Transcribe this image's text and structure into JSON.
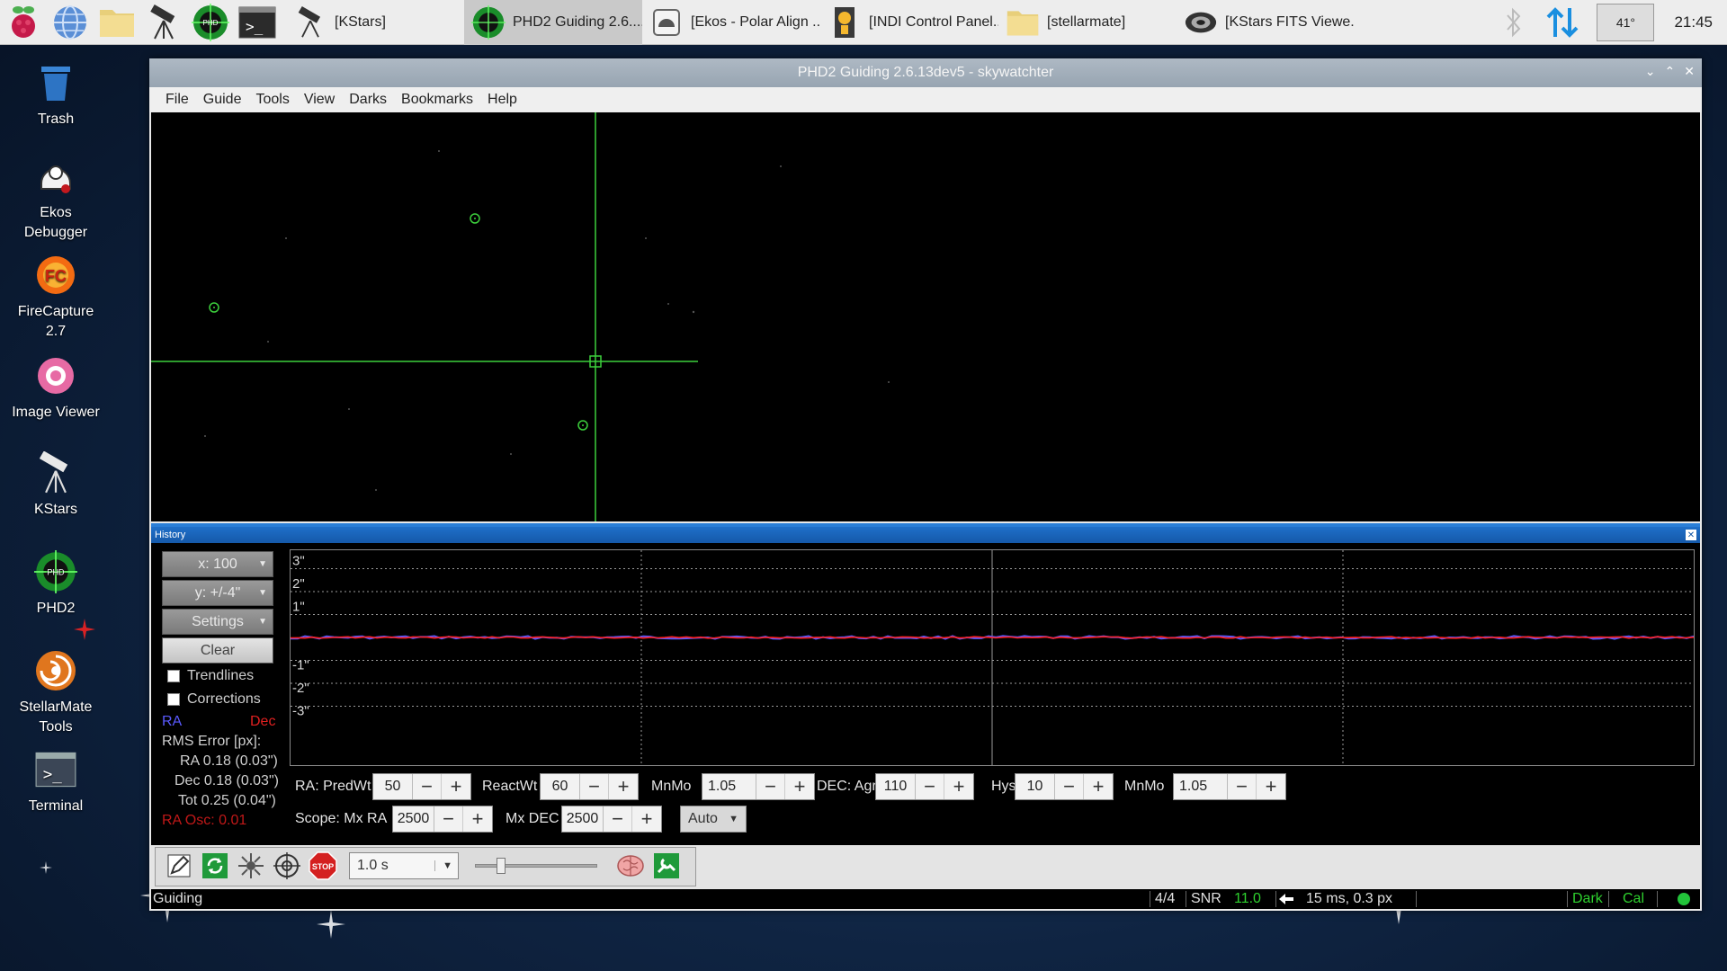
{
  "taskbar": {
    "tasks": [
      {
        "label": "[KStars]",
        "icon": "telescope-icon"
      },
      {
        "label": "PHD2 Guiding 2.6....",
        "icon": "phd2-icon",
        "active": true
      },
      {
        "label": "[Ekos - Polar Align ...",
        "icon": "ekos-icon"
      },
      {
        "label": "[INDI Control Panel...",
        "icon": "indi-icon"
      },
      {
        "label": "[stellarmate]",
        "icon": "folder-icon"
      },
      {
        "label": "[KStars FITS Viewe...",
        "icon": "fits-viewer-icon"
      }
    ],
    "temperature": "41°",
    "clock": "21:45"
  },
  "desktop": {
    "icons": [
      {
        "label": "Trash"
      },
      {
        "label": "Ekos\nDebugger"
      },
      {
        "label": "FireCapture\n2.7"
      },
      {
        "label": "Image Viewer"
      },
      {
        "label": "KStars"
      },
      {
        "label": "PHD2"
      },
      {
        "label": "StellarMate\nTools"
      },
      {
        "label": "Terminal"
      }
    ]
  },
  "window": {
    "title": "PHD2 Guiding 2.6.13dev5 - skywatchter",
    "menu": [
      "File",
      "Guide",
      "Tools",
      "View",
      "Darks",
      "Bookmarks",
      "Help"
    ]
  },
  "history": {
    "title": "History",
    "x_scale": "x: 100",
    "y_scale": "y: +/-4\"",
    "settings": "Settings",
    "clear": "Clear",
    "trendlines": "Trendlines",
    "corrections": "Corrections",
    "ra_label": "RA",
    "dec_label": "Dec",
    "rms_title": "RMS Error [px]:",
    "rms_ra": "RA 0.18 (0.03\")",
    "rms_dec": "Dec 0.18 (0.03\")",
    "rms_tot": "Tot 0.25 (0.04\")",
    "ra_osc": "RA Osc: 0.01",
    "y_ticks": [
      "3\"",
      "2\"",
      "1\"",
      "-1\"",
      "-2\"",
      "-3\""
    ],
    "colors": {
      "ra": "#5a5aff",
      "dec": "#ff2020",
      "grid": "#9a9a9a"
    }
  },
  "controls": {
    "ra_predwt_label": "RA: PredWt",
    "ra_predwt": "50",
    "reactwt_label": "ReactWt",
    "reactwt": "60",
    "mnmo_label": "MnMo",
    "mnmo_ra": "1.05",
    "dec_agr_label": "DEC: Agr",
    "dec_agr": "110",
    "hys_label": "Hys",
    "hys": "10",
    "mnmo_dec": "1.05",
    "scope_mxra_label": "Scope: Mx RA",
    "scope_mxra": "2500",
    "mxdec_label": "Mx DEC",
    "mxdec": "2500",
    "dec_mode": "Auto",
    "minus": "−",
    "plus": "+"
  },
  "toolbar": {
    "exposure": "1.0 s"
  },
  "status": {
    "state": "Guiding",
    "frames": "4/4",
    "snr_label": "SNR",
    "snr": "11.0",
    "pulse": "15 ms, 0.3 px",
    "dark": "Dark",
    "cal": "Cal"
  }
}
